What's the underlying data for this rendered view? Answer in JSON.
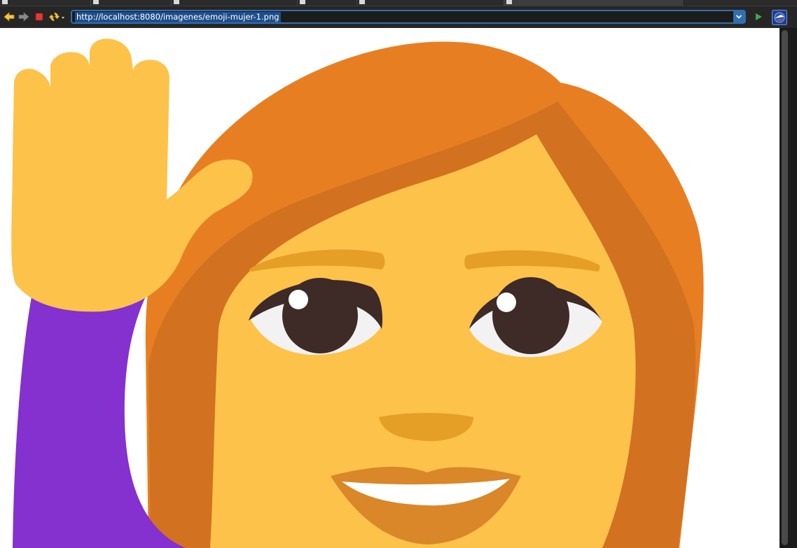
{
  "browser": {
    "address_bar": {
      "url": "http://localhost:8080/imagenes/emoji-mujer-1.png"
    },
    "toolbar": {
      "back_icon": "arrow-left-icon",
      "forward_icon": "arrow-right-icon",
      "stop_icon": "stop-icon",
      "refresh_icon": "refresh-icon",
      "go_icon": "play-icon",
      "extra_icon": "navigator-icon"
    }
  },
  "image": {
    "subject": "woman-raising-hand-emoji",
    "colors": {
      "hair": "#E87E22",
      "hair_shadow": "#D2711F",
      "skin": "#FDC24A",
      "eyebrows": "#E59E26",
      "eye_white": "#F2F2F2",
      "iris": "#3E2A26",
      "sleeve": "#8431CF",
      "lips": "#D98729"
    }
  },
  "colors": {
    "accent": "#2F6FB0",
    "url_selection": "#1F4E8C",
    "stop_red": "#E03A3A",
    "go_green": "#3DA84A"
  }
}
